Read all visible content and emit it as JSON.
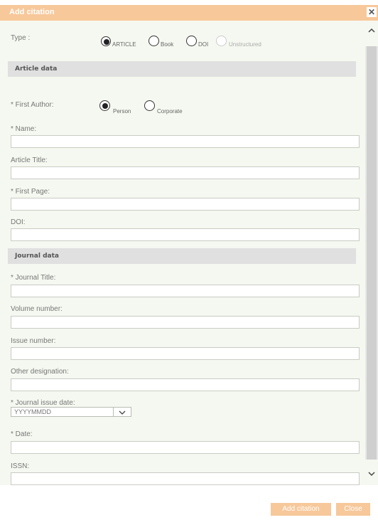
{
  "dialog": {
    "title": "Add citation",
    "close_glyph": "✕"
  },
  "type_row": {
    "label": "Type :",
    "options": [
      {
        "label": "ARTICLE",
        "checked": true,
        "disabled": false
      },
      {
        "label": "Book",
        "checked": false,
        "disabled": false
      },
      {
        "label": "DOI",
        "checked": false,
        "disabled": false
      },
      {
        "label": "Unstructured",
        "checked": false,
        "disabled": true
      }
    ]
  },
  "article_section": {
    "header": "Article data",
    "first_author": {
      "label": "* First Author:",
      "options": [
        {
          "label": "Person",
          "checked": true
        },
        {
          "label": "Corporate",
          "checked": false
        }
      ]
    },
    "fields": [
      {
        "label": "* Name:",
        "value": ""
      },
      {
        "label": "Article Title:",
        "value": ""
      },
      {
        "label": "* First Page:",
        "value": ""
      },
      {
        "label": "DOI:",
        "value": ""
      }
    ]
  },
  "journal_section": {
    "header": "Journal data",
    "fields": [
      {
        "label": "* Journal Title:",
        "value": ""
      },
      {
        "label": "Volume number:",
        "value": ""
      },
      {
        "label": "Issue number:",
        "value": ""
      },
      {
        "label": "Other designation:",
        "value": ""
      }
    ],
    "issue_date": {
      "label": "* Journal issue date:",
      "selected": "YYYYMMDD"
    },
    "date_field": {
      "label": "* Date:",
      "value": ""
    },
    "issn_field": {
      "label": "ISSN:",
      "value": ""
    }
  },
  "buttons": {
    "add_citation": "Add citation",
    "close": "Close"
  },
  "colors": {
    "accent": "#f7c89a",
    "panel_bg": "#f5f8f0",
    "section_bg": "#e0e0e0"
  }
}
